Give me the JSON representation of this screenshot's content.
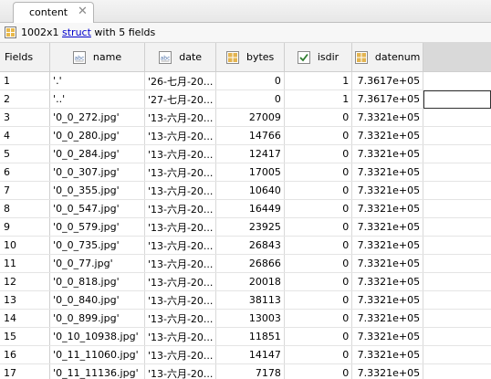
{
  "tab": {
    "label": "content",
    "close": "✕"
  },
  "info": {
    "size": "1002x1",
    "link": "struct",
    "suffix": "with 5 fields"
  },
  "columns": {
    "corner": "Fields",
    "name": "name",
    "date": "date",
    "bytes": "bytes",
    "isdir": "isdir",
    "datenum": "datenum"
  },
  "rows": [
    {
      "index": "1",
      "name": "'.'",
      "date": "'26-七月-20...",
      "bytes": "0",
      "isdir": "1",
      "datenum": "7.3617e+05"
    },
    {
      "index": "2",
      "name": "'..'",
      "date": "'27-七月-20...",
      "bytes": "0",
      "isdir": "1",
      "datenum": "7.3617e+05"
    },
    {
      "index": "3",
      "name": "'0_0_272.jpg'",
      "date": "'13-六月-20...",
      "bytes": "27009",
      "isdir": "0",
      "datenum": "7.3321e+05"
    },
    {
      "index": "4",
      "name": "'0_0_280.jpg'",
      "date": "'13-六月-20...",
      "bytes": "14766",
      "isdir": "0",
      "datenum": "7.3321e+05"
    },
    {
      "index": "5",
      "name": "'0_0_284.jpg'",
      "date": "'13-六月-20...",
      "bytes": "12417",
      "isdir": "0",
      "datenum": "7.3321e+05"
    },
    {
      "index": "6",
      "name": "'0_0_307.jpg'",
      "date": "'13-六月-20...",
      "bytes": "17005",
      "isdir": "0",
      "datenum": "7.3321e+05"
    },
    {
      "index": "7",
      "name": "'0_0_355.jpg'",
      "date": "'13-六月-20...",
      "bytes": "10640",
      "isdir": "0",
      "datenum": "7.3321e+05"
    },
    {
      "index": "8",
      "name": "'0_0_547.jpg'",
      "date": "'13-六月-20...",
      "bytes": "16449",
      "isdir": "0",
      "datenum": "7.3321e+05"
    },
    {
      "index": "9",
      "name": "'0_0_579.jpg'",
      "date": "'13-六月-20...",
      "bytes": "23925",
      "isdir": "0",
      "datenum": "7.3321e+05"
    },
    {
      "index": "10",
      "name": "'0_0_735.jpg'",
      "date": "'13-六月-20...",
      "bytes": "26843",
      "isdir": "0",
      "datenum": "7.3321e+05"
    },
    {
      "index": "11",
      "name": "'0_0_77.jpg'",
      "date": "'13-六月-20...",
      "bytes": "26866",
      "isdir": "0",
      "datenum": "7.3321e+05"
    },
    {
      "index": "12",
      "name": "'0_0_818.jpg'",
      "date": "'13-六月-20...",
      "bytes": "20018",
      "isdir": "0",
      "datenum": "7.3321e+05"
    },
    {
      "index": "13",
      "name": "'0_0_840.jpg'",
      "date": "'13-六月-20...",
      "bytes": "38113",
      "isdir": "0",
      "datenum": "7.3321e+05"
    },
    {
      "index": "14",
      "name": "'0_0_899.jpg'",
      "date": "'13-六月-20...",
      "bytes": "13003",
      "isdir": "0",
      "datenum": "7.3321e+05"
    },
    {
      "index": "15",
      "name": "'0_10_10938.jpg'",
      "date": "'13-六月-20...",
      "bytes": "11851",
      "isdir": "0",
      "datenum": "7.3321e+05"
    },
    {
      "index": "16",
      "name": "'0_11_11060.jpg'",
      "date": "'13-六月-20...",
      "bytes": "14147",
      "isdir": "0",
      "datenum": "7.3321e+05"
    },
    {
      "index": "17",
      "name": "'0_11_11136.jpg'",
      "date": "'13-六月-20...",
      "bytes": "7178",
      "isdir": "0",
      "datenum": "7.3321e+05"
    }
  ]
}
